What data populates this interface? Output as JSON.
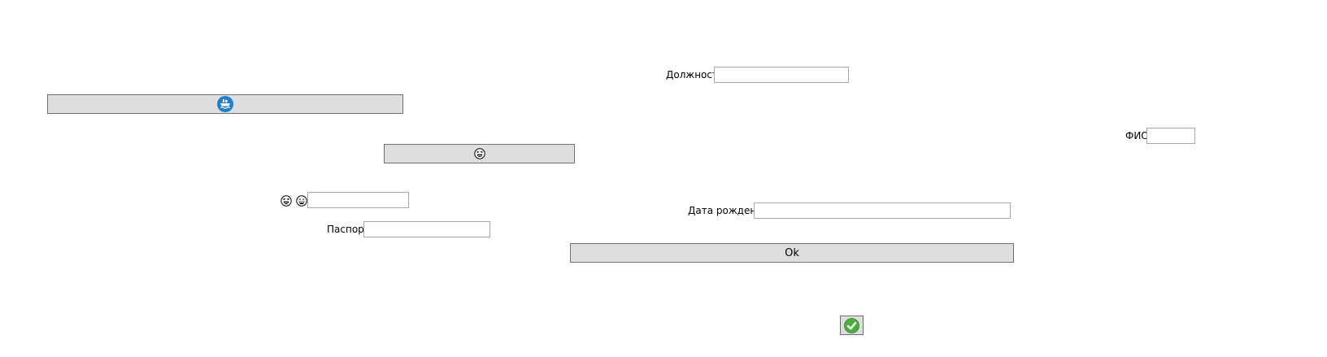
{
  "form": {
    "position_label": "Должность",
    "position_value": "",
    "fio_label": "ФИО",
    "fio_value": "",
    "birthdate_label": "Дата рождения",
    "birthdate_value": "",
    "passport_label": "Паспорт",
    "passport_value": "",
    "emoji_field_value": "",
    "ok_label": "Ok"
  },
  "icons": {
    "ship_button_icon": "ship-icon",
    "laugh_button_icon": "laughing-face-icon",
    "emoji_label_icons": [
      "laughing-face-icon",
      "grinning-face-icon"
    ],
    "confirm_icon": "green-checkmark-icon"
  },
  "colors": {
    "ship_icon": "#1e7fd0",
    "check_icon": "#4caf3d",
    "button_bg": "#dedede"
  }
}
